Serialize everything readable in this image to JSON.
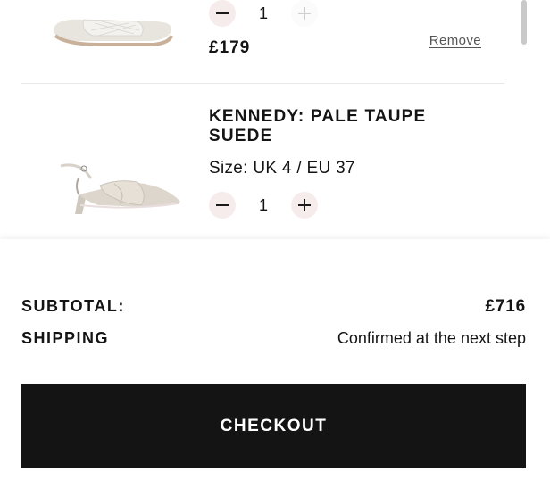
{
  "cart": {
    "items": [
      {
        "price": "£179",
        "quantity": "1",
        "remove_label": "Remove"
      },
      {
        "name": "KENNEDY: PALE TAUPE SUEDE",
        "size": "Size: UK 4 / EU 37",
        "quantity": "1"
      }
    ]
  },
  "summary": {
    "subtotal_label": "SUBTOTAL:",
    "subtotal_value": "£716",
    "shipping_label": "SHIPPING",
    "shipping_value": "Confirmed at the next step",
    "checkout_label": "CHECKOUT"
  },
  "colors": {
    "button_bg": "#141414",
    "qty_button_bg": "#f7ecec",
    "text": "#141414"
  }
}
